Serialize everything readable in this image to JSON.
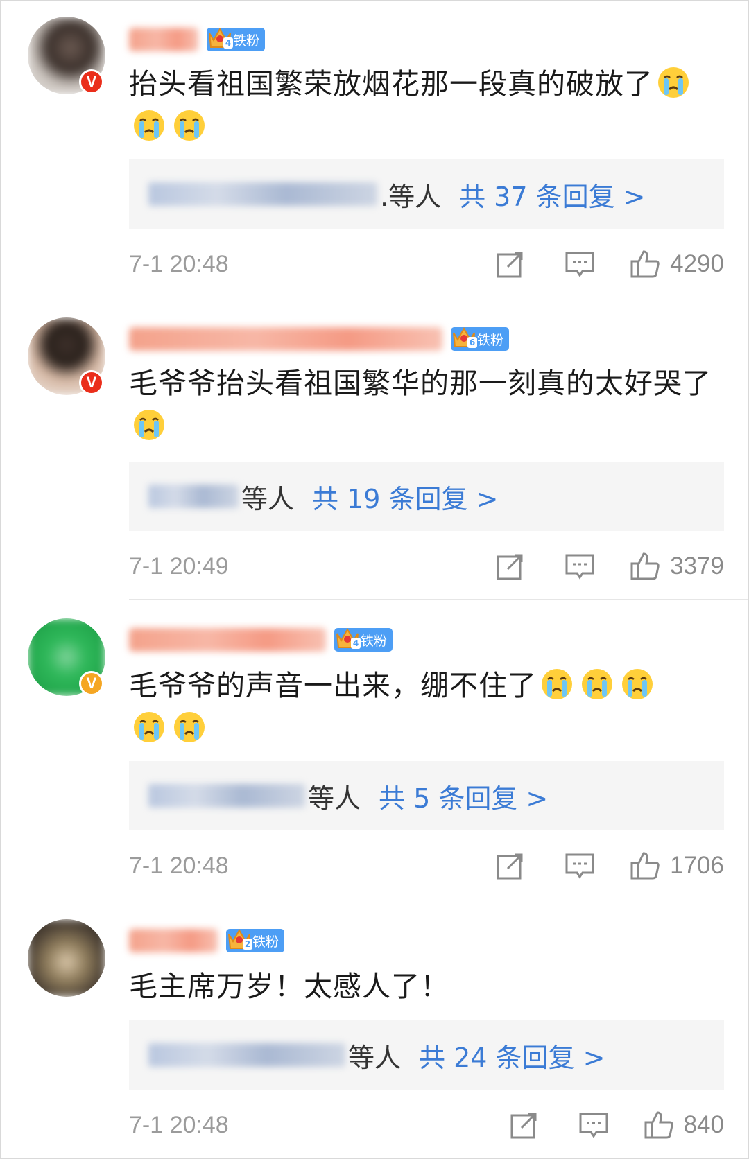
{
  "comments": [
    {
      "fan_badge": "铁粉",
      "fan_level": "4",
      "text": "抬头看祖国繁荣放烟花那一段真的破放了",
      "reply_suffix": ".等人",
      "reply_total": "共 37 条回复 >",
      "time": "7-1 20:48",
      "likes": "4290",
      "badge_color": "#ea2e1b"
    },
    {
      "fan_badge": "铁粉",
      "fan_level": "6",
      "text": "毛爷爷抬头看祖国繁华的那一刻真的太好哭了",
      "reply_suffix": "等人",
      "reply_total": "共 19 条回复 >",
      "time": "7-1 20:49",
      "likes": "3379",
      "badge_color": "#ea2e1b"
    },
    {
      "fan_badge": "铁粉",
      "fan_level": "4",
      "text": "毛爷爷的声音一出来，绷不住了",
      "reply_suffix": "等人",
      "reply_total": "共 5 条回复 >",
      "time": "7-1 20:48",
      "likes": "1706",
      "badge_color": "#f5a623"
    },
    {
      "fan_badge": "铁粉",
      "fan_level": "2",
      "text": "毛主席万岁！太感人了！",
      "reply_suffix": "等人",
      "reply_total": "共 24 条回复 >",
      "time": "7-1 20:48",
      "likes": "840",
      "badge_color": ""
    }
  ],
  "icons": {
    "verified": "verified-v-icon",
    "emoji": "crying-face-emoji",
    "share": "share-icon",
    "reply": "comment-icon",
    "like": "thumbs-up-icon"
  },
  "colors": {
    "link_blue": "#3b7bd5",
    "fan_badge_blue": "#4d9ef5",
    "meta_gray": "#9b9b9b"
  }
}
